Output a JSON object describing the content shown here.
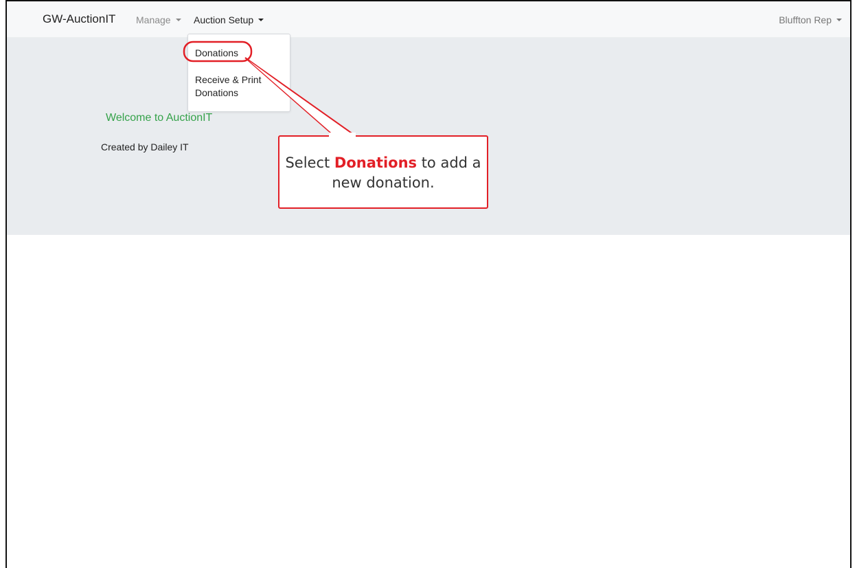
{
  "navbar": {
    "brand": "GW-AuctionIT",
    "manage_label": "Manage",
    "auction_setup_label": "Auction Setup",
    "user_label": "Bluffton Rep"
  },
  "dropdown": {
    "items": [
      {
        "label": "Donations"
      },
      {
        "label_line1": "Receive & Print",
        "label_line2": "Donations"
      }
    ]
  },
  "main": {
    "welcome": "Welcome to AuctionIT",
    "created_by": "Created by Dailey IT"
  },
  "callout": {
    "text_before": "Select ",
    "text_bold": "Donations",
    "text_after": " to add a new donation.",
    "accent_color": "#e21f26"
  },
  "colors": {
    "welcome_green": "#35a24a",
    "jumbotron_bg": "#e9ecef",
    "navbar_bg": "#f7f8f9"
  }
}
